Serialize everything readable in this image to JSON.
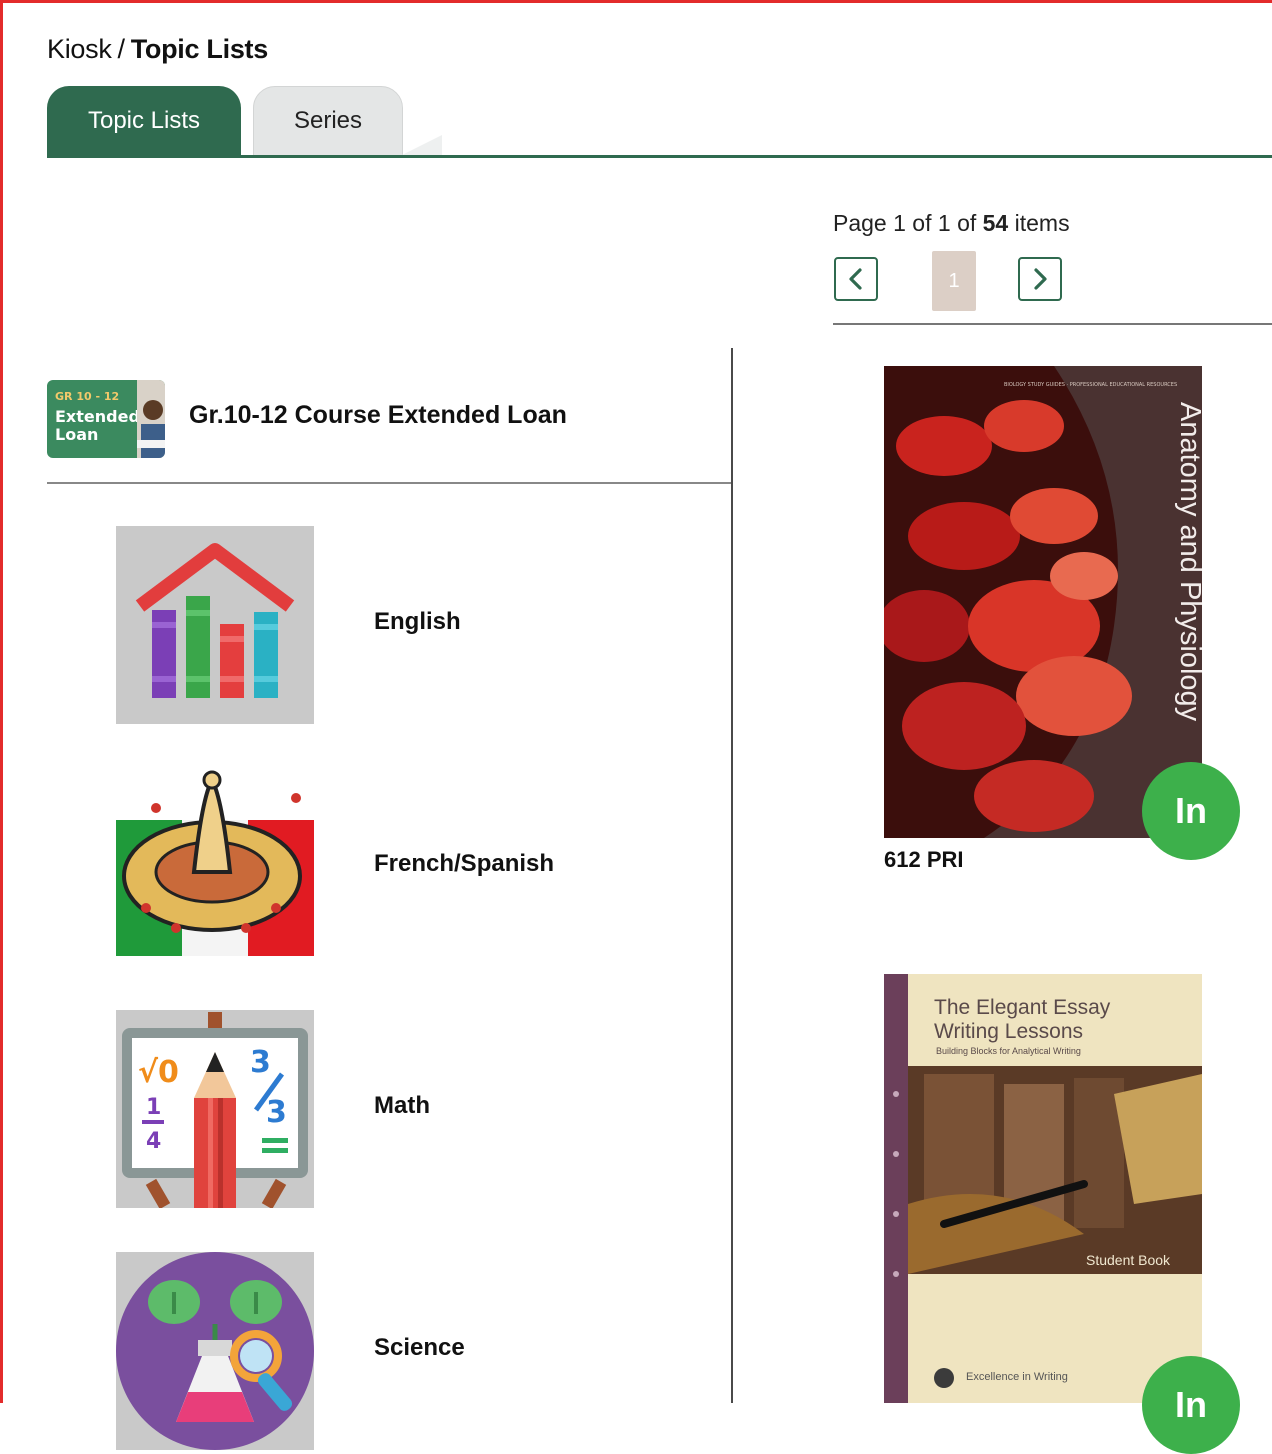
{
  "breadcrumb": {
    "root": "Kiosk",
    "separator": "/",
    "current": "Topic Lists"
  },
  "tabs": [
    {
      "label": "Topic Lists",
      "active": true
    },
    {
      "label": "Series",
      "active": false
    }
  ],
  "pager": {
    "page_word": "Page",
    "current": "1",
    "of_word": "of",
    "total_pages": "1",
    "of_word2": "of",
    "items": "54",
    "items_word": "items",
    "page_button": "1"
  },
  "parent_topic": {
    "title": "Gr.10-12 Course Extended Loan",
    "thumb_line1": "GR 10 - 12",
    "thumb_line2": "Extended",
    "thumb_line3": "Loan"
  },
  "topics": [
    {
      "label": "English",
      "icon": "bookshelf-icon"
    },
    {
      "label": "French/Spanish",
      "icon": "sombrero-icon"
    },
    {
      "label": "Math",
      "icon": "math-easel-icon"
    },
    {
      "label": "Science",
      "icon": "science-flask-icon"
    }
  ],
  "books": [
    {
      "spine_title": "Anatomy and Physiology",
      "call_number": "612 PRI",
      "status": "In"
    },
    {
      "cover_title_1": "The Elegant Essay",
      "cover_title_2": "Writing Lessons",
      "cover_subtitle": "Building Blocks for Analytical Writing",
      "cover_note": "Student Book",
      "publisher": "Excellence in Writing",
      "status": "In"
    }
  ],
  "colors": {
    "accent": "#2f6a4f",
    "badge": "#3db04b",
    "frame": "#e32b2b"
  }
}
